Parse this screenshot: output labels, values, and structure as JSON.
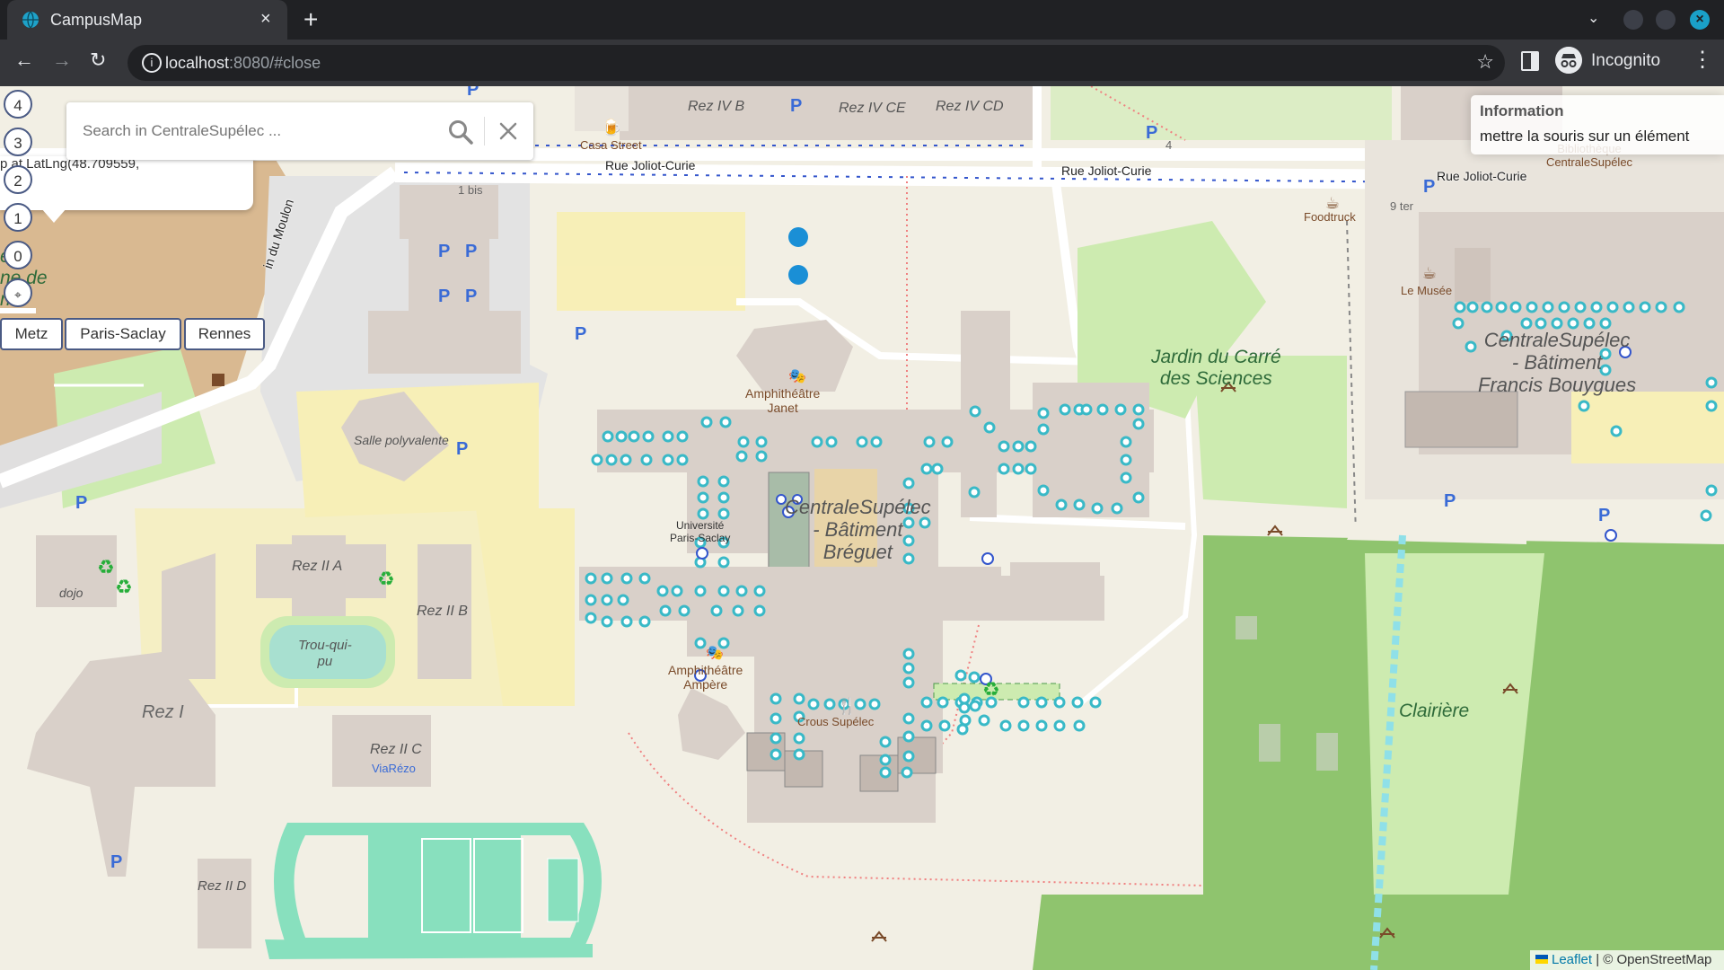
{
  "browser": {
    "tab_title": "CampusMap",
    "tab_close": "×",
    "new_tab": "+",
    "url_host": "localhost",
    "url_rest": ":8080/#close",
    "incognito_label": "Incognito",
    "back": "←",
    "forward": "→",
    "reload": "↻",
    "menu": "⋮",
    "tab_search": "⌄"
  },
  "search": {
    "placeholder": "Search in CentraleSupélec ..."
  },
  "popup": {
    "text": "p at LatLng(48.709559,"
  },
  "floors": [
    "4",
    "3",
    "2",
    "1",
    "0",
    "⌖"
  ],
  "campus_buttons": [
    "Metz",
    "Paris-Saclay",
    "Rennes"
  ],
  "info_panel": {
    "title": "Information",
    "body": "mettre la souris sur un élément"
  },
  "attribution": {
    "leaflet": "Leaflet",
    "rest": " | © OpenStreetMap"
  },
  "map_labels": {
    "rez_iv_b": "Rez IV B",
    "rez_iv_ce": "Rez IV CE",
    "rez_iv_cd": "Rez IV CD",
    "casa_street": "Casa Street",
    "rue_joliot_curie_1": "Rue Joliot-Curie",
    "rue_joliot_curie_2": "Rue Joliot-Curie",
    "rue_joliot_curie_3": "Rue Joliot-Curie",
    "num_4": "4",
    "num_1bis": "1 bis",
    "num_9ter": "9 ter",
    "foodtruck": "Foodtruck",
    "le_musee": "Le Musée",
    "bibliotheque": "Bibliothèque CentraleSupélec",
    "moulon": "in du Moulon",
    "parc_fragment": "e la\nne de\nn",
    "salle_polyvalente": "Salle polyvalente",
    "amphi_janet": "Amphithéâtre\nJanet",
    "jardin": "Jardin du Carré\ndes Sciences",
    "bouygues": "CentraleSupélec\n- Bâtiment\nFrancis Bouygues",
    "breguet": "CentraleSupélec\n- Bâtiment\nBréguet",
    "universite": "Université\nParis-Saclay",
    "rez_ii_a": "Rez II A",
    "rez_ii_b": "Rez II B",
    "rez_ii_c": "Rez II C",
    "rez_ii_d": "Rez II D",
    "rez_i": "Rez I",
    "dojo": "dojo",
    "trou_qui_pu": "Trou-qui-\npu",
    "viarezo": "ViaRézo",
    "amphi_ampere": "Amphithéâtre\nAmpère",
    "crous": "Crous Supélec",
    "clairiere": "Clairière"
  },
  "colors": {
    "map_bg": "#f2efe4",
    "building": "#d9d0c9",
    "campus_area": "#f7efb7",
    "park": "#cdebb0",
    "forest": "#8fc46e",
    "pitch": "#88e0be",
    "road": "#ffffff",
    "indoor_marker": "#39b9c7",
    "accent_border": "#4a5a84"
  }
}
